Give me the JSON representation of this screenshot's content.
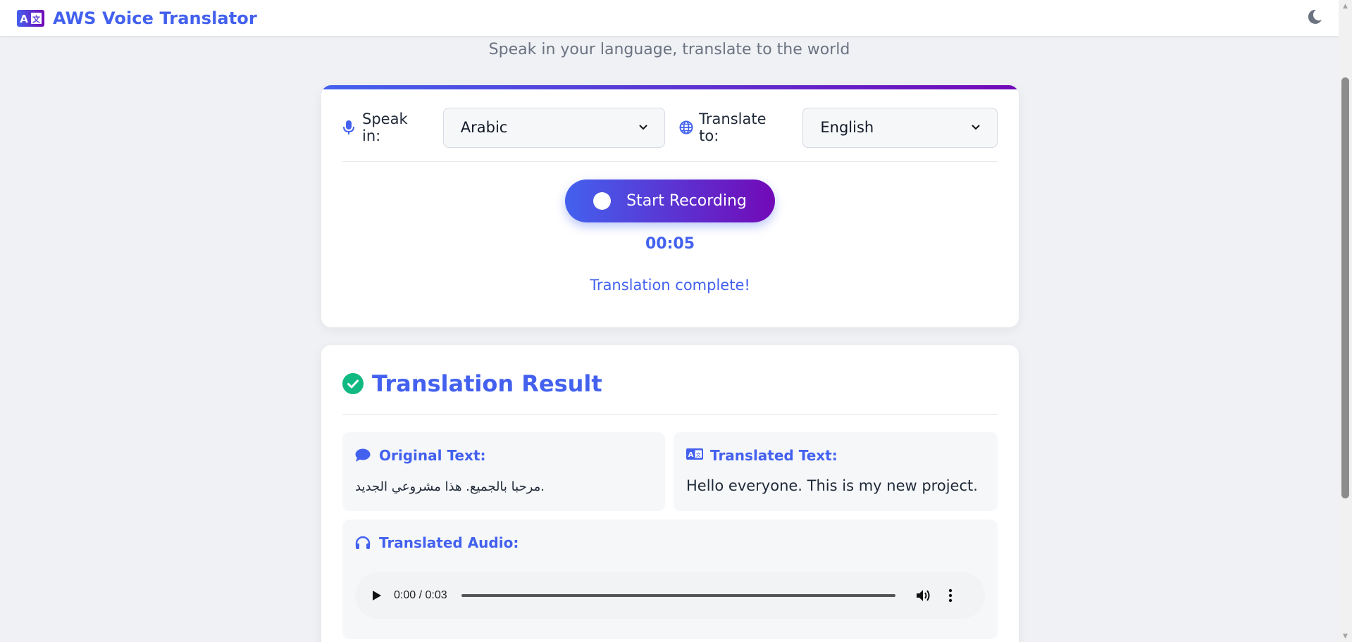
{
  "app": {
    "title": "AWS Voice Translator",
    "subtitle": "Speak in your language, translate to the world",
    "accent_color": "#4361ee",
    "gradient_end_color": "#7209b7",
    "icons": {
      "brand": "translate-icon",
      "theme": "moon-icon"
    }
  },
  "controls": {
    "speak_label": "Speak in:",
    "speak_value": "Arabic",
    "translate_label": "Translate to:",
    "translate_value": "English",
    "record_button": "Start Recording",
    "timer": "00:05",
    "status": "Translation complete!"
  },
  "result": {
    "title": "Translation Result",
    "original_title": "Original Text:",
    "original_text": "مرحبا بالجميع. هذا مشروعي الجديد.",
    "translated_title": "Translated Text:",
    "translated_text": "Hello everyone. This is my new project.",
    "audio_title": "Translated Audio:",
    "audio_time": "0:00 / 0:03",
    "success_color": "#10b981"
  }
}
